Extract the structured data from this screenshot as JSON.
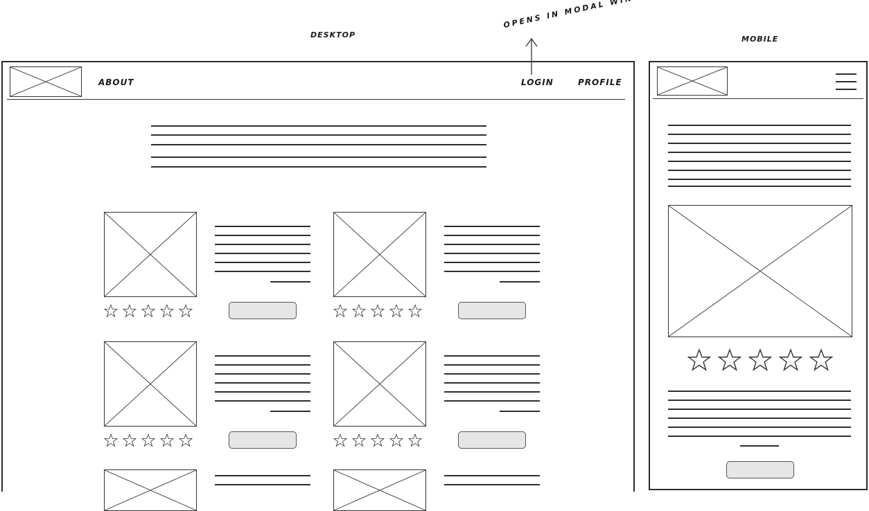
{
  "labels": {
    "desktop": "DESKTOP",
    "mobile": "MOBILE",
    "annotation": "OPENS IN MODAL WINDOW"
  },
  "desktop_nav": {
    "about": "ABOUT",
    "login": "LOGIN",
    "profile": "PROFILE"
  },
  "icons": {
    "logo": "image-placeholder-icon",
    "star": "star-icon",
    "menu": "hamburger-menu-icon",
    "arrow": "arrow-up-icon"
  },
  "ratings": {
    "max_stars": 5
  }
}
